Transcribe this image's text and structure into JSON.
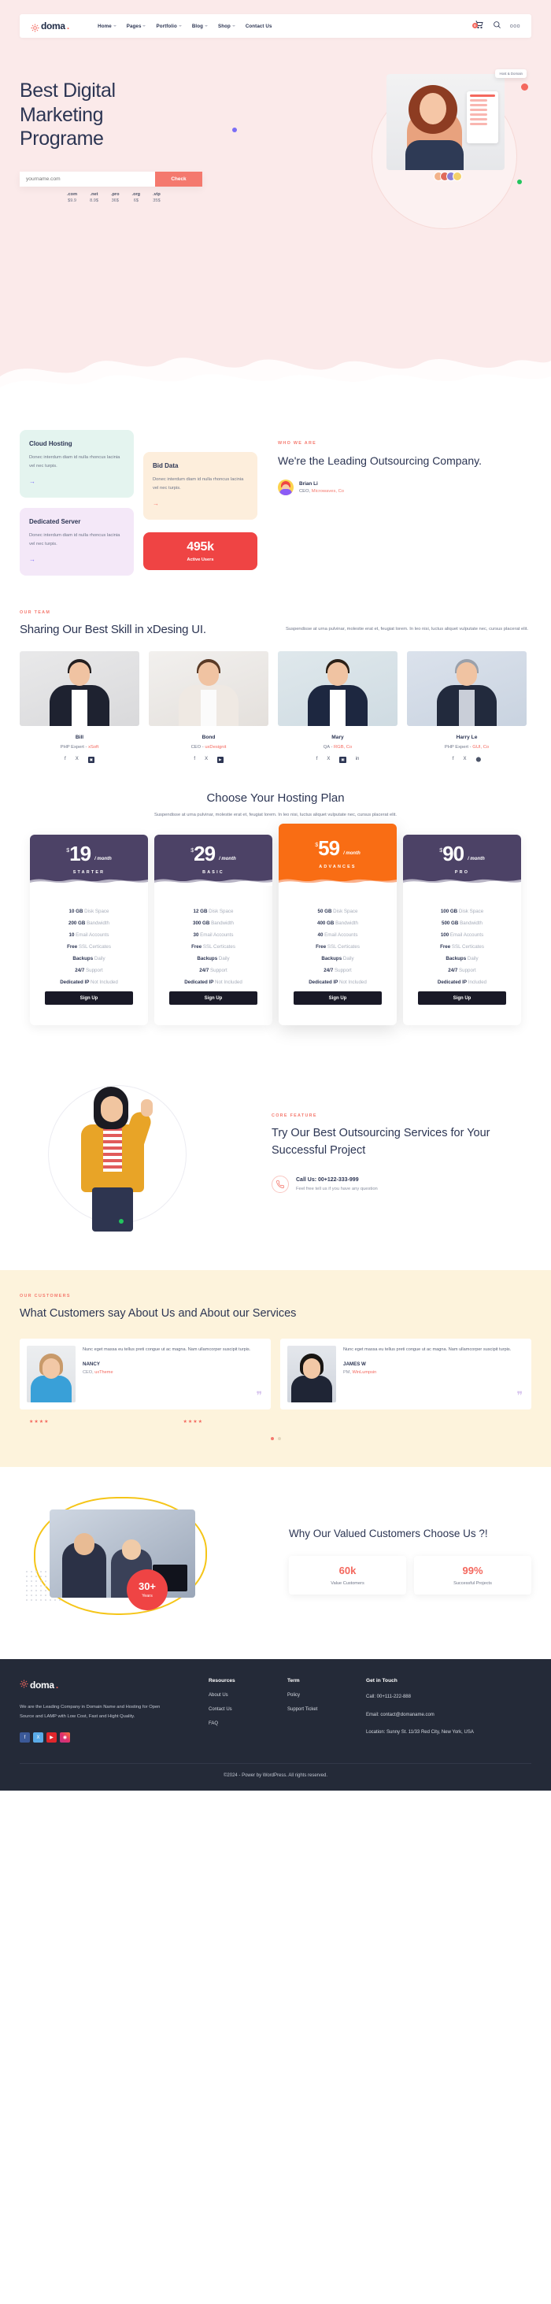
{
  "nav": {
    "logo_text": "doma",
    "logo_dot": ".",
    "links": [
      "Home",
      "Pages",
      "Portfolio",
      "Blog",
      "Shop",
      "Contact Us"
    ],
    "cart_count": "0",
    "search_icon": "search-icon",
    "more_icon": "ooo"
  },
  "hero": {
    "title_line1": "Best Digital",
    "title_line2": "Marketing",
    "title_line3": "Programe",
    "input_placeholder": "yourname.com",
    "input_value": "",
    "check_button": "Check",
    "tlds": [
      {
        "name": ".com",
        "price": "$9.9"
      },
      {
        "name": ".net",
        "price": "8.9$"
      },
      {
        "name": ".pro",
        "price": "36$"
      },
      {
        "name": ".org",
        "price": "6$"
      },
      {
        "name": ".vip",
        "price": "35$"
      }
    ],
    "chip": "Host & Domain"
  },
  "services": {
    "cards": [
      {
        "title": "Cloud Hosting",
        "desc": "Donec interdum diam id nulla rhoncus lacinia vel nec turpis.",
        "arrow": "→"
      },
      {
        "title": "Bid Data",
        "desc": "Donec interdum diam id nulla rhoncus lacinia vel nec turpis.",
        "arrow": "→"
      },
      {
        "title": "Dedicated Server",
        "desc": "Donec interdum diam id nulla rhoncus lacinia vel nec turpis.",
        "arrow": "→"
      }
    ],
    "stat_number": "495k",
    "stat_label": "Active Users",
    "about_eyebrow": "WHO WE ARE",
    "about_title": "We're the Leading Outsourcing Company.",
    "person_name": "Brian Li",
    "person_role_prefix": "CEO, ",
    "person_role_company": "Microwaves, Co"
  },
  "team": {
    "eyebrow": "OUR TEAM",
    "title": "Sharing Our Best Skill in xDesing UI.",
    "desc": "Suspendisse at urna pulvinar, molestie erat et, feugiat lorem. In leo nisi, luctus aliquet vulputate nec, cursus placerat elit.",
    "members": [
      {
        "name": "Bill",
        "role_prefix": "PHP Expert - ",
        "role_company": "xSoft",
        "socials": [
          "f",
          "X",
          "ig"
        ]
      },
      {
        "name": "Bond",
        "role_prefix": "CEO - ",
        "role_company": "uxDesignit",
        "socials": [
          "f",
          "X",
          "yt"
        ]
      },
      {
        "name": "Mary",
        "role_prefix": "QA - ",
        "role_company": "RGB, Co",
        "socials": [
          "f",
          "X",
          "ig",
          "in"
        ]
      },
      {
        "name": "Harry Le",
        "role_prefix": "PHP Expert - ",
        "role_company": "GUI, Co",
        "socials": [
          "f",
          "X",
          "gh"
        ]
      }
    ]
  },
  "pricing": {
    "title": "Choose Your Hosting Plan",
    "subtitle": "Suspendisse at urna pulvinar, molestie erat et, feugiat lorem. In leo nisi, luctus aliquet vulputate nec, cursus placerat elit.",
    "currency": "$",
    "per": "/ month",
    "button_label": "Sign Up",
    "plans": [
      {
        "price": "19",
        "tier": "STARTER",
        "featured": false,
        "features": [
          {
            "b": "10 GB",
            "t": " Disk Space"
          },
          {
            "b": "200 GB",
            "t": " Bandwidth"
          },
          {
            "b": "10",
            "t": " Email Accounts"
          },
          {
            "b": "Free",
            "t": " SSL Certicates"
          },
          {
            "b": "Backups",
            "t": " Daily"
          },
          {
            "b": "24/7",
            "t": " Support"
          },
          {
            "b": "Dedicated IP",
            "t": " Not Included"
          }
        ]
      },
      {
        "price": "29",
        "tier": "BASIC",
        "featured": false,
        "features": [
          {
            "b": "12 GB",
            "t": " Disk Space"
          },
          {
            "b": "300 GB",
            "t": " Bandwidth"
          },
          {
            "b": "30",
            "t": " Email Accounts"
          },
          {
            "b": "Free",
            "t": " SSL Certicates"
          },
          {
            "b": "Backups",
            "t": " Daily"
          },
          {
            "b": "24/7",
            "t": " Support"
          },
          {
            "b": "Dedicated IP",
            "t": " Not Included"
          }
        ]
      },
      {
        "price": "59",
        "tier": "ADVANCES",
        "featured": true,
        "features": [
          {
            "b": "50 GB",
            "t": " Disk Space"
          },
          {
            "b": "400 GB",
            "t": " Bandwidth"
          },
          {
            "b": "40",
            "t": " Email Accounts"
          },
          {
            "b": "Free",
            "t": " SSL Certicates"
          },
          {
            "b": "Backups",
            "t": " Daily"
          },
          {
            "b": "24/7",
            "t": " Support"
          },
          {
            "b": "Dedicated IP",
            "t": " Not Included"
          }
        ]
      },
      {
        "price": "90",
        "tier": "PRO",
        "featured": false,
        "features": [
          {
            "b": "100 GB",
            "t": " Disk Space"
          },
          {
            "b": "500 GB",
            "t": " Bandwidth"
          },
          {
            "b": "100",
            "t": " Email Accounts"
          },
          {
            "b": "Free",
            "t": " SSL Certicates"
          },
          {
            "b": "Backups",
            "t": " Daily"
          },
          {
            "b": "24/7",
            "t": " Support"
          },
          {
            "b": "Dedicated IP",
            "t": " Included"
          }
        ]
      }
    ]
  },
  "cta": {
    "eyebrow": "CORE FEATURE",
    "title": "Try Our Best Outsourcing Services for Your Successful Project",
    "call_title": "Call Us: 00+122-333-999",
    "call_sub": "Feel free tell us if you have any question",
    "phone_icon": "phone-icon"
  },
  "testimonials": {
    "eyebrow": "OUR CUSTOMERS",
    "title": "What Customers say About Us and About our Services",
    "items": [
      {
        "text": "Nunc eget massa eu tellus preti congue ut ac magna. Nam ullamcorper suscipit turpis.",
        "name": "NANCY",
        "role_prefix": "CEO, ",
        "role_company": "uxTheme",
        "stars": "★★★★",
        "quote": "❞"
      },
      {
        "text": "Nunc eget massa eu tellus preti congue ut ac magna. Nam ullamcorper suscipit turpis.",
        "name": "JAMES W",
        "role_prefix": "PM, ",
        "role_company": "WinLumpsin",
        "stars": "★★★★",
        "quote": "❞"
      }
    ]
  },
  "why": {
    "title": "Why Our Valued Customers Choose Us ?!",
    "badge_number": "30+",
    "badge_text": "Years",
    "stats": [
      {
        "number": "60k",
        "label": "Value Customers"
      },
      {
        "number": "99%",
        "label": "Successful Projects"
      }
    ]
  },
  "footer": {
    "logo_text": "doma",
    "logo_dot": ".",
    "description": "We are the Leading Company  in Domain Name and Hosting for Open Source and LAMP with Low Cost, Fast and Hight Quality.",
    "socials": [
      "f",
      "X",
      "▶",
      "◉"
    ],
    "columns": [
      {
        "heading": "Resources",
        "links": [
          "About Us",
          "Contact Us",
          "FAQ"
        ]
      },
      {
        "heading": "Term",
        "links": [
          "Policy",
          "Support Ticket"
        ]
      }
    ],
    "contact_heading": "Get in Touch",
    "contact_call": "Call: 00+111-222-888",
    "contact_email": "Email: contact@domaname.com",
    "contact_location": "Location: Sunny St. 11/33 Red City, New York, USA",
    "copyright": "©2024 - Power by WordPress. All rights reserved."
  },
  "colors": {
    "accent": "#f4685e",
    "dark": "#2c3553",
    "orange": "#f96d14",
    "plum": "#4c4266",
    "cream": "#fdf3dc",
    "footer": "#242a38"
  }
}
